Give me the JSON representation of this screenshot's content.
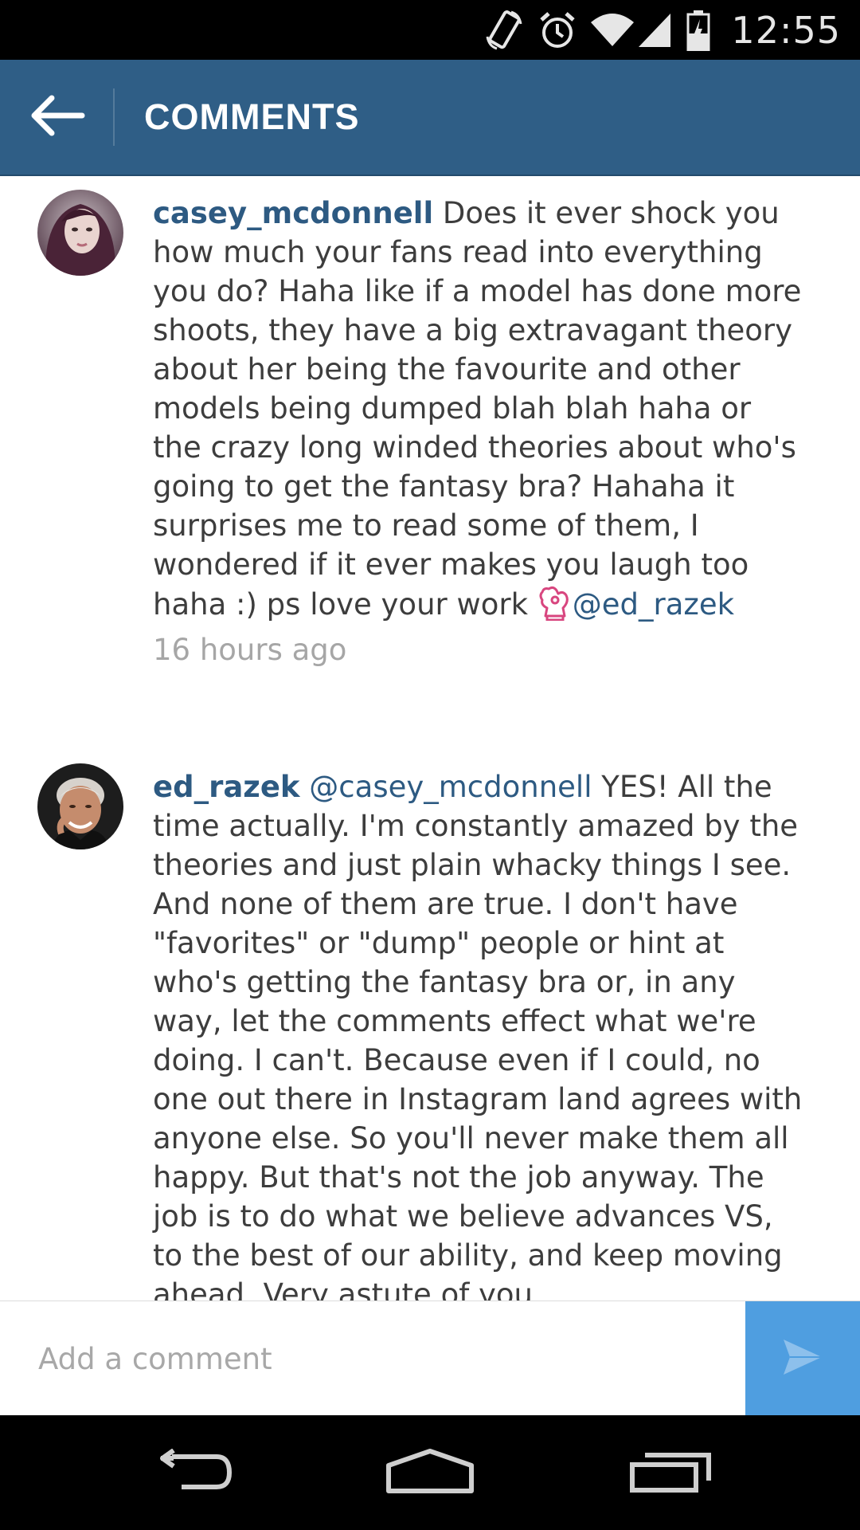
{
  "status_bar": {
    "time": "12:55",
    "icons": [
      "screen-rotation-icon",
      "alarm-icon",
      "wifi-icon",
      "cell-signal-icon",
      "battery-icon"
    ]
  },
  "header": {
    "title": "COMMENTS",
    "back_icon": "back-arrow-icon",
    "background_color": "#2f5e86"
  },
  "comments": [
    {
      "username": "casey_mcdonnell",
      "text": " Does it ever shock you how much your fans read into everything you do? Haha like if a model has done more shoots, they have a big extravagant theory about her being the favourite and other models being dumped blah blah haha or the crazy long winded theories about who's going to get the fantasy bra? Hahaha it surprises me to read some of them, I wondered if it ever makes you laugh too haha :) ps love your work ",
      "emoji": "ok-hand-emoji",
      "mention": "@ed_razek",
      "timestamp": "16 hours ago"
    },
    {
      "username": "ed_razek",
      "mention": "@casey_mcdonnell",
      "text": " YES! All the time actually. I'm constantly amazed by the theories and just plain whacky things I see. And none of them are true. I don't have \"favorites\" or \"dump\" people or hint at who's getting the fantasy bra or, in any way, let the comments effect what we're doing. I can't. Because even if I could, no one out there in Instagram land agrees with anyone else. So you'll never make them all happy. But that's not the job anyway. The job is to do what we believe advances VS, to the best of our ability, and keep moving ahead. Very astute of you"
    }
  ],
  "comment_input": {
    "placeholder": "Add a comment",
    "value": ""
  },
  "send_button": {
    "icon": "send-icon",
    "color": "#4f9ee0"
  },
  "nav_bar": {
    "icons": [
      "back-icon",
      "home-icon",
      "recent-apps-icon"
    ]
  }
}
